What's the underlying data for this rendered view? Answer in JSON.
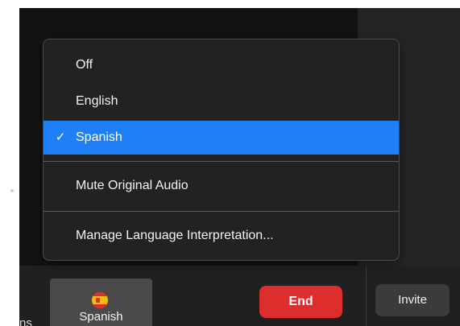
{
  "menu": {
    "items": [
      {
        "label": "Off",
        "checked": false
      },
      {
        "label": "English",
        "checked": false
      },
      {
        "label": "Spanish",
        "checked": true
      },
      {
        "label": "Mute Original Audio",
        "checked": false
      },
      {
        "label": "Manage Language Interpretation...",
        "checked": false
      }
    ],
    "check_glyph": "✓"
  },
  "toolbar": {
    "left_fragment": "ns",
    "spanish_label": "Spanish",
    "end_label": "End",
    "invite_label": "Invite"
  },
  "colors": {
    "selection_blue": "#1f7ff5",
    "end_red": "#dd2d2d",
    "invite_bg": "#3b3b3b",
    "menu_bg": "#222222"
  },
  "icons": {
    "language_flag": "spain-flag-icon",
    "checkmark": "checkmark-icon"
  }
}
